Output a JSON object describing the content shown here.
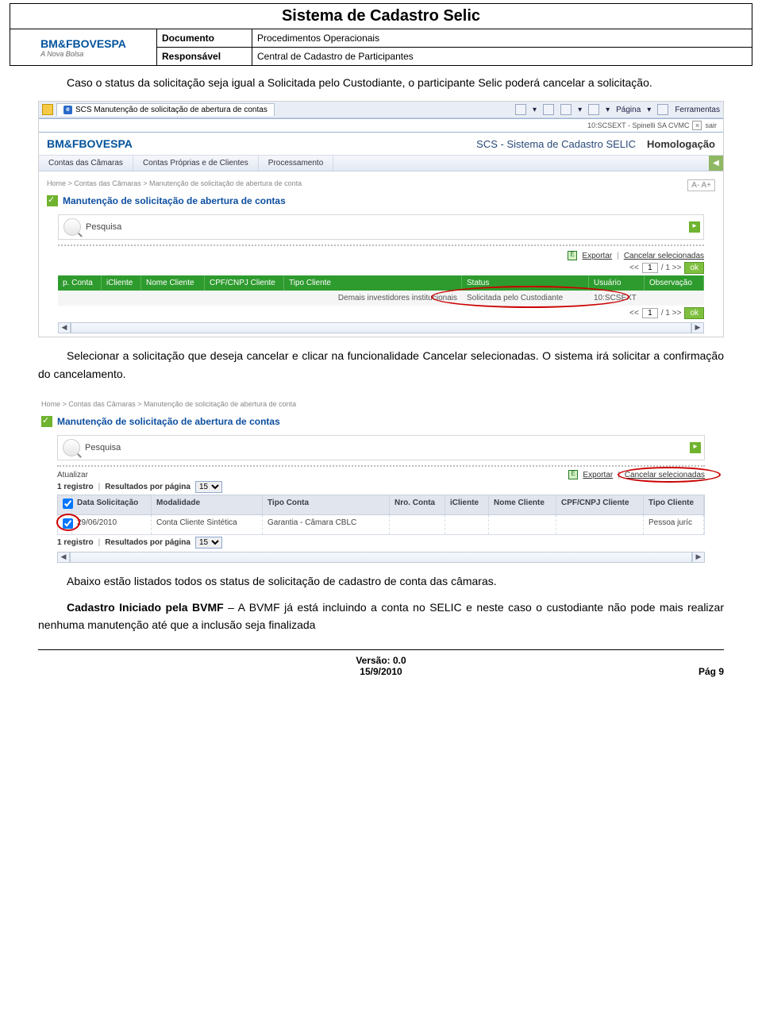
{
  "doc": {
    "title": "Sistema de Cadastro Selic",
    "logo_main": "BM&FBOVESPA",
    "logo_sub": "A Nova Bolsa",
    "meta": {
      "documento_label": "Documento",
      "documento_value": "Procedimentos Operacionais",
      "responsavel_label": "Responsável",
      "responsavel_value": "Central de Cadastro de Participantes"
    }
  },
  "para1": "Caso o status da solicitação seja igual a Solicitada pelo Custodiante, o participante Selic poderá cancelar a solicitação.",
  "para2": "Selecionar a solicitação que deseja cancelar e clicar na funcionalidade Cancelar selecionadas. O sistema irá solicitar a confirmação do cancelamento.",
  "para3": "Abaixo estão listados todos os status de solicitação de cadastro de conta das câmaras.",
  "para4_bold": "Cadastro Iniciado pela BVMF",
  "para4_rest": " – A BVMF já está incluindo a conta no SELIC e neste caso o custodiante não pode mais realizar nenhuma manutenção até que a inclusão seja finalizada",
  "shot1": {
    "tab_title": "SCS Manutenção de solicitação de abertura de contas",
    "toolbar": {
      "pagina": "Página",
      "ferramentas": "Ferramentas"
    },
    "session": "10:SCSEXT - Spinelli SA CVMC",
    "sair": "sair",
    "app_brand": "BM&FBOVESPA",
    "app_title": "SCS - Sistema de Cadastro SELIC",
    "homolog": "Homologação",
    "menu": {
      "m1": "Contas das Câmaras",
      "m2": "Contas Próprias e de Clientes",
      "m3": "Processamento"
    },
    "breadcrumb": "Home > Contas das Câmaras > Manutenção de solicitação de abertura de conta",
    "fontsize": "A- A+",
    "section": "Manutenção de solicitação de abertura de contas",
    "pesquisa": "Pesquisa",
    "exportar": "Exportar",
    "cancelar": "Cancelar selecionadas",
    "pager": {
      "prev": "<<",
      "page": "1",
      "total": "/ 1 >>",
      "ok": "ok"
    },
    "headers": {
      "h1": "p. Conta",
      "h2": "iCliente",
      "h3": "Nome Cliente",
      "h4": "CPF/CNPJ Cliente",
      "h5": "Tipo Cliente",
      "h6": "Status",
      "h7": "Usuário",
      "h8": "Observação"
    },
    "row": {
      "tipo_cliente": "Demais investidores institucionais",
      "status": "Solicitada pelo Custodiante",
      "usuario": "10:SCSEXT"
    }
  },
  "shot2": {
    "breadcrumb": "Home > Contas das Câmaras > Manutenção de solicitação de abertura de conta",
    "section": "Manutenção de solicitação de abertura de contas",
    "pesquisa": "Pesquisa",
    "atualizar": "Atualizar",
    "exportar": "Exportar",
    "cancelar": "Cancelar selecionadas",
    "info": {
      "count_label": "1 registro",
      "results_label": "Resultados por página",
      "perpage": "15"
    },
    "headers": {
      "h1": "Data Solicitação",
      "h2": "Modalidade",
      "h3": "Tipo Conta",
      "h4": "Nro. Conta",
      "h5": "iCliente",
      "h6": "Nome Cliente",
      "h7": "CPF/CNPJ Cliente",
      "h8": "Tipo Cliente"
    },
    "row": {
      "data": "29/06/2010",
      "modalidade": "Conta Cliente Sintética",
      "tipo_conta": "Garantia - Câmara CBLC",
      "tipo_cliente": "Pessoa juríc"
    }
  },
  "footer": {
    "version": "Versão: 0.0",
    "date": "15/9/2010",
    "page": "Pág 9"
  }
}
